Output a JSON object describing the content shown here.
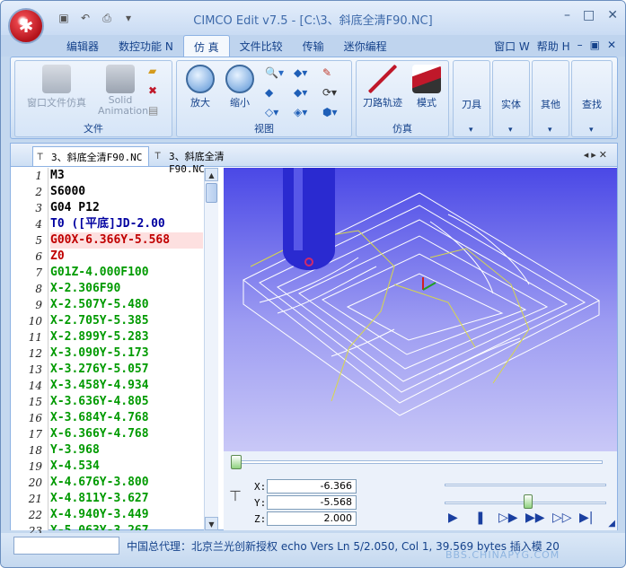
{
  "app": {
    "title": "CIMCO Edit v7.5 - [C:\\3、斜底全清F90.NC]"
  },
  "ribbon_tabs": [
    "编辑器",
    "数控功能 N",
    "仿 真",
    "文件比较",
    "传输",
    "迷你编程"
  ],
  "ribbon_right": {
    "window": "窗口 W",
    "help": "帮助 H"
  },
  "ribbon": {
    "file_group": {
      "label": "文件",
      "window_file_sim": "窗口文件仿真",
      "solid_anim_1": "Solid",
      "solid_anim_2": "Animation"
    },
    "view_group": {
      "label": "视图",
      "zoom_in": "放大",
      "zoom_out": "缩小"
    },
    "sim_group": {
      "label": "仿真",
      "toolpath": "刀路轨迹",
      "mode": "模式"
    },
    "tool": "刀具",
    "solid": "实体",
    "other": "其他",
    "find": "查找"
  },
  "doc_tabs": [
    "3、斜底全清F90.NC",
    "3、斜底全清F90.NC"
  ],
  "code_lines": [
    {
      "n": "1",
      "t": "M3",
      "c": "#000000"
    },
    {
      "n": "2",
      "t": "S6000",
      "c": "#000000"
    },
    {
      "n": "3",
      "t": "G04 P12",
      "c": "#000000"
    },
    {
      "n": "4",
      "t": "T0 ([平底]JD-2.00",
      "c": "#0000a0"
    },
    {
      "n": "5",
      "t": "G00X-6.366Y-5.568",
      "c": "#c00000"
    },
    {
      "n": "6",
      "t": "Z0",
      "c": "#c00000"
    },
    {
      "n": "7",
      "t": "G01Z-4.000F100",
      "c": "#009a00"
    },
    {
      "n": "8",
      "t": "X-2.306F90",
      "c": "#009a00"
    },
    {
      "n": "9",
      "t": "X-2.507Y-5.480",
      "c": "#009a00"
    },
    {
      "n": "10",
      "t": "X-2.705Y-5.385",
      "c": "#009a00"
    },
    {
      "n": "11",
      "t": "X-2.899Y-5.283",
      "c": "#009a00"
    },
    {
      "n": "12",
      "t": "X-3.090Y-5.173",
      "c": "#009a00"
    },
    {
      "n": "13",
      "t": "X-3.276Y-5.057",
      "c": "#009a00"
    },
    {
      "n": "14",
      "t": "X-3.458Y-4.934",
      "c": "#009a00"
    },
    {
      "n": "15",
      "t": "X-3.636Y-4.805",
      "c": "#009a00"
    },
    {
      "n": "16",
      "t": "X-3.684Y-4.768",
      "c": "#009a00"
    },
    {
      "n": "17",
      "t": "X-6.366Y-4.768",
      "c": "#009a00"
    },
    {
      "n": "18",
      "t": "Y-3.968",
      "c": "#009a00"
    },
    {
      "n": "19",
      "t": "X-4.534",
      "c": "#009a00"
    },
    {
      "n": "20",
      "t": "X-4.676Y-3.800",
      "c": "#009a00"
    },
    {
      "n": "21",
      "t": "X-4.811Y-3.627",
      "c": "#009a00"
    },
    {
      "n": "22",
      "t": "X-4.940Y-3.449",
      "c": "#009a00"
    },
    {
      "n": "23",
      "t": "X-5.063Y-3.267",
      "c": "#009a00"
    }
  ],
  "coords": {
    "x_label": "X:",
    "x": "-6.366",
    "y_label": "Y:",
    "y": "-5.568",
    "z_label": "Z:",
    "z": "2.000"
  },
  "status": {
    "text": "中国总代理：北京兰光创新授权 echo Vers Ln 5/2.050, Col 1, 39.569 bytes 插入模 20"
  },
  "watermark": "BBS.CHINAPYG.COM"
}
